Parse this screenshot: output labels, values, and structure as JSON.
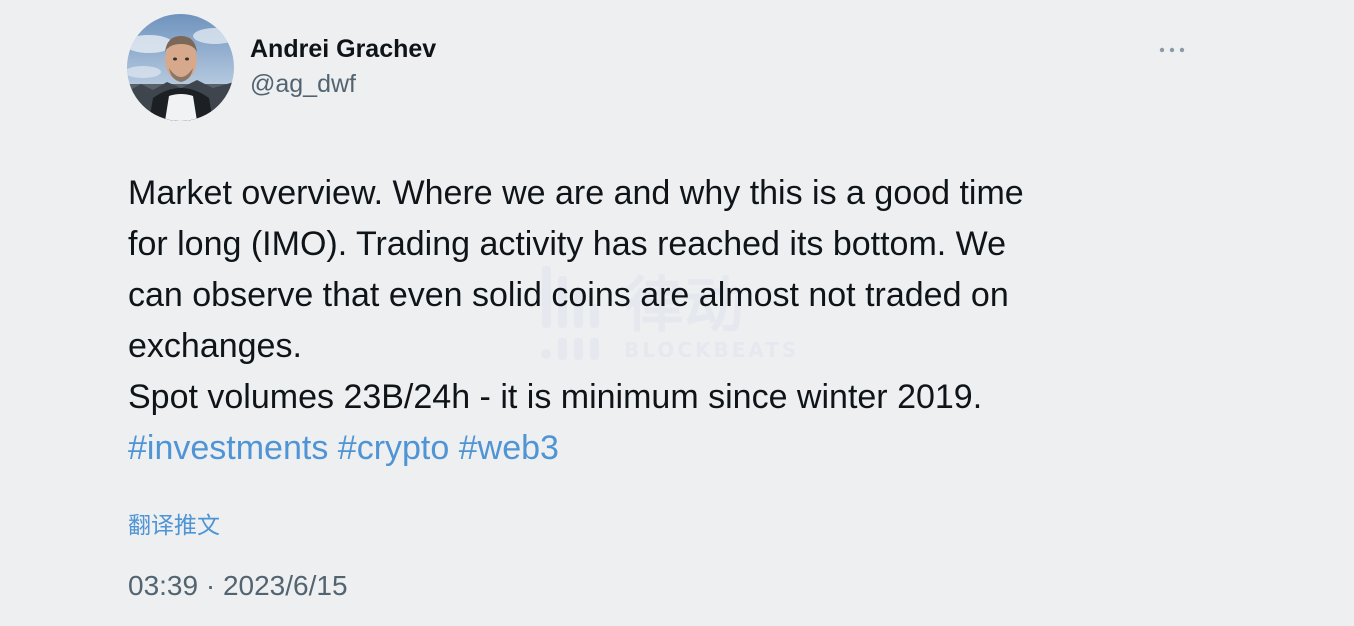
{
  "user": {
    "name": "Andrei Grachev",
    "handle": "@ag_dwf",
    "avatar_icon": "avatar-photo"
  },
  "more_icon": "more-dots-icon",
  "tweet": {
    "lines": [
      "Market overview. Where we are and why this is a good time",
      "for long (IMO). Trading activity has reached its bottom. We",
      "can observe that even solid coins are almost not traded on",
      "exchanges.",
      "Spot volumes 23B/24h - it is minimum since winter 2019."
    ],
    "hashtags": [
      "#investments",
      "#crypto",
      "#web3"
    ]
  },
  "translate_label": "翻译推文",
  "timestamp": "03:39 · 2023/6/15",
  "watermark": {
    "cn": "律动",
    "en": "BLOCKBEATS"
  },
  "colors": {
    "background": "#eeeff1",
    "text": "#0f1419",
    "secondary": "#536471",
    "link": "#4f94d4"
  }
}
